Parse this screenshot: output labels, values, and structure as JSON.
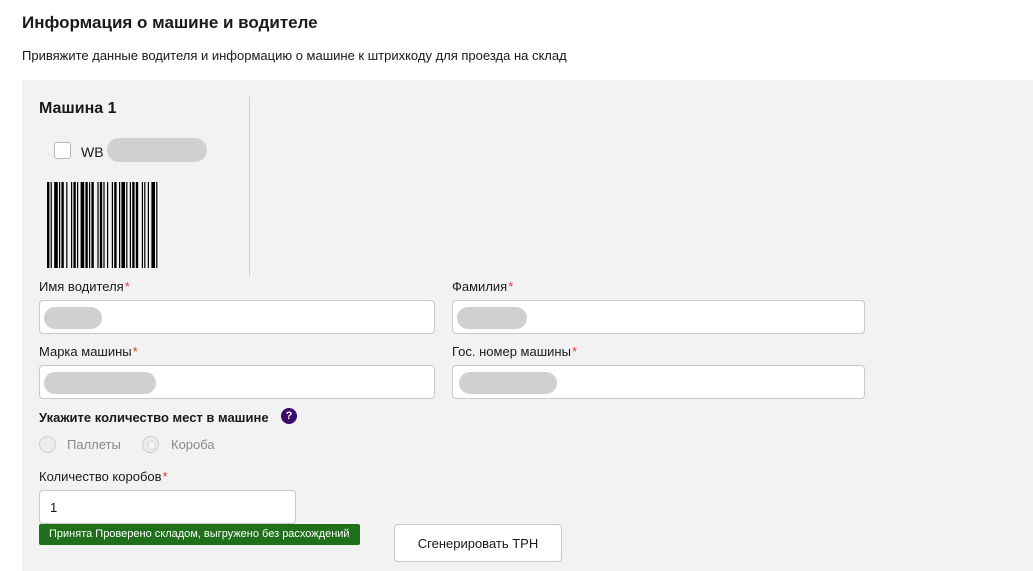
{
  "header": {
    "title": "Информация о машине и водителе",
    "subtitle": "Привяжите данные водителя и информацию о машине к штрихкоду для проезда на склад"
  },
  "car": {
    "title": "Машина 1",
    "barcode_prefix": "WB",
    "barcode_checked": false
  },
  "form": {
    "driver_first_name": {
      "label": "Имя водителя",
      "required_mark": "*",
      "value": ""
    },
    "driver_last_name": {
      "label": "Фамилия",
      "required_mark": "*",
      "value": ""
    },
    "car_brand": {
      "label": "Марка машины",
      "required_mark": "*",
      "value": ""
    },
    "car_plate": {
      "label": "Гос. номер машины",
      "required_mark": "*",
      "value": ""
    },
    "places": {
      "label": "Укажите количество мест в машине",
      "help_icon": "?",
      "options": [
        {
          "label": "Паллеты",
          "selected": false
        },
        {
          "label": "Короба",
          "selected": true
        }
      ]
    },
    "box_count": {
      "label": "Количество коробов",
      "required_mark": "*",
      "value": "1"
    }
  },
  "status_badge": {
    "text": "Принята Проверено складом, выгружено без расхождений",
    "color": "#1f6f1b"
  },
  "actions": {
    "generate_label": "Сгенерировать ТРН"
  },
  "colors": {
    "panel_bg": "#f2f2f2",
    "required": "#e53935",
    "help_icon": "#3a0a6b"
  }
}
